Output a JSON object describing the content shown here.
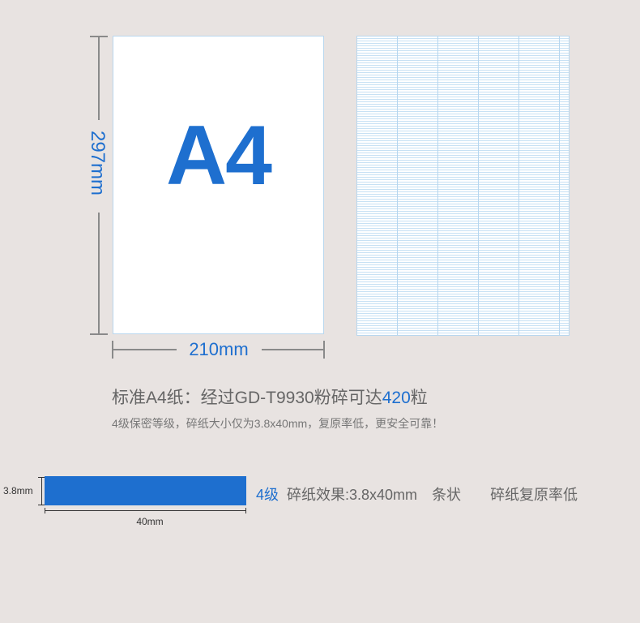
{
  "dimension": {
    "height_label": "297mm",
    "width_label": "210mm"
  },
  "sheet": {
    "label": "A4"
  },
  "caption": {
    "main_prefix": "标准A4纸：经过GD-T9930粉碎可达",
    "main_count": "420",
    "main_suffix": "粒",
    "sub": "4级保密等级，碎纸大小仅为3.8x40mm，复原率低，更安全可靠！"
  },
  "strip_sample": {
    "height_label": "3.8mm",
    "width_label": "40mm",
    "level": "4级",
    "effect": "碎纸效果:3.8x40mm",
    "shape": "条状",
    "recovery": "碎纸复原率低"
  },
  "colors": {
    "accent": "#1e6fcf",
    "background": "#e8e3e1",
    "text": "#666666"
  }
}
